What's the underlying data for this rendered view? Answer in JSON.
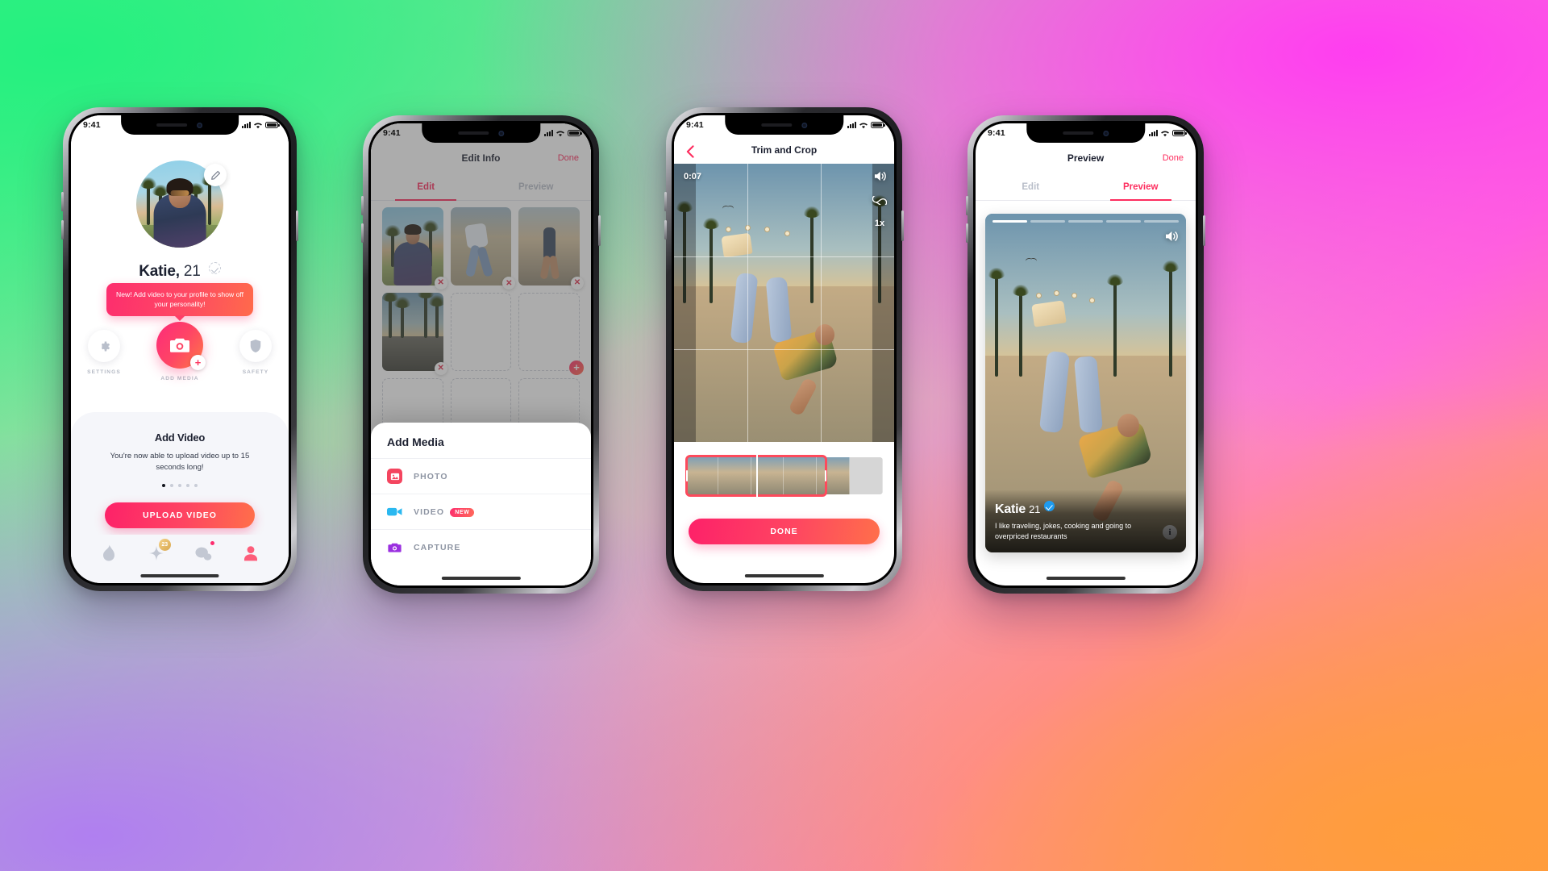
{
  "status_bar": {
    "time": "9:41"
  },
  "phone1": {
    "profile": {
      "name": "Katie,",
      "age": "21",
      "avatar_alt": "profile-photo",
      "edit_icon": "pencil-icon",
      "verified_icon": "verification-pending-icon"
    },
    "tooltip": {
      "text": "New! Add video to your profile to show off your personality!"
    },
    "actions": [
      {
        "label": "SETTINGS",
        "icon": "gear-icon"
      },
      {
        "label": "ADD MEDIA",
        "icon": "camera-icon"
      },
      {
        "label": "SAFETY",
        "icon": "shield-icon"
      }
    ],
    "promo_card": {
      "title": "Add Video",
      "body": "You're now able to upload video up to 15 seconds long!",
      "dots_total": 5,
      "dots_active": 1,
      "button": "UPLOAD VIDEO"
    },
    "bottom_nav": [
      {
        "name": "flame-icon",
        "badge": ""
      },
      {
        "name": "star-icon",
        "badge": "23"
      },
      {
        "name": "chat-icon",
        "badge": "dot"
      },
      {
        "name": "profile-icon",
        "badge": ""
      }
    ]
  },
  "phone2": {
    "header": {
      "title": "Edit Info",
      "done": "Done"
    },
    "tabs": [
      {
        "label": "Edit",
        "active": true
      },
      {
        "label": "Preview",
        "active": false
      }
    ],
    "grid": [
      {
        "filled": true,
        "alt": "photo-portrait"
      },
      {
        "filled": true,
        "alt": "photo-skater"
      },
      {
        "filled": true,
        "alt": "photo-running"
      },
      {
        "filled": true,
        "alt": "photo-palms"
      },
      {
        "filled": false,
        "alt": "empty-slot"
      },
      {
        "filled": false,
        "alt": "empty-slot"
      },
      {
        "filled": false,
        "alt": "empty-slot"
      },
      {
        "filled": false,
        "alt": "empty-slot"
      },
      {
        "filled": false,
        "alt": "empty-slot"
      }
    ],
    "sheet": {
      "title": "Add Media",
      "items": [
        {
          "label": "PHOTO",
          "icon": "image-icon",
          "badge": "",
          "color": "#f4455f"
        },
        {
          "label": "VIDEO",
          "icon": "camcorder-icon",
          "badge": "NEW",
          "color": "#2ab8f0"
        },
        {
          "label": "CAPTURE",
          "icon": "camera-icon",
          "badge": "",
          "color": "#9b30e0"
        }
      ]
    }
  },
  "phone3": {
    "header": {
      "title": "Trim and Crop",
      "back_icon": "chevron-left-icon"
    },
    "video": {
      "timecode": "0:07",
      "sound_icon": "speaker-on-icon",
      "loop_icon": "loop-icon",
      "speed": "1x"
    },
    "button": "DONE"
  },
  "phone4": {
    "header": {
      "title": "Preview",
      "done": "Done"
    },
    "tabs": [
      {
        "label": "Edit",
        "active": false
      },
      {
        "label": "Preview",
        "active": true
      }
    ],
    "card": {
      "name": "Katie",
      "age": "21",
      "verified_icon": "verified-badge-icon",
      "bio": "I like traveling, jokes, cooking and going to overpriced restaurants",
      "sound_icon": "speaker-on-icon",
      "info_icon": "info-icon",
      "progress_total": 5,
      "progress_active": 1
    }
  },
  "colors": {
    "accent_pink": "#fd2d6e",
    "accent_orange": "#ff6f4a",
    "blue": "#2ab8f0",
    "purple": "#9b30e0"
  }
}
